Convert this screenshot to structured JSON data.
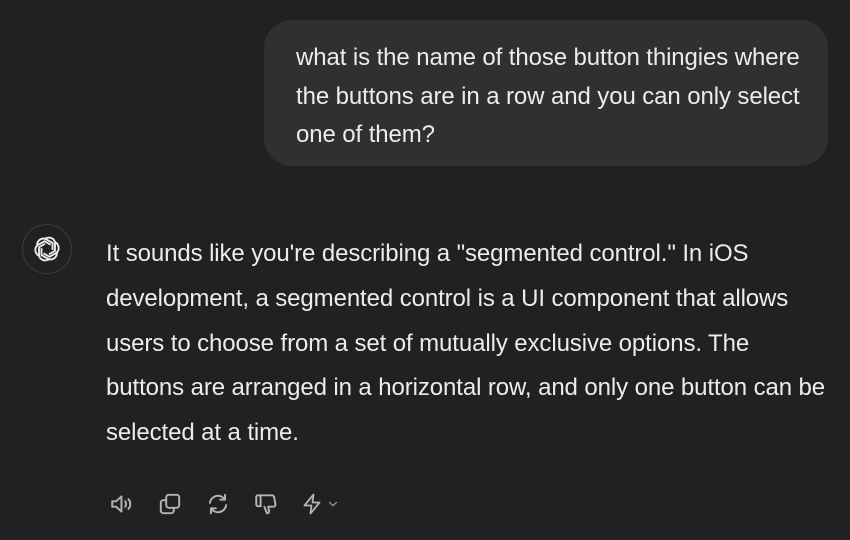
{
  "user_message": {
    "text": "what is the name of those button thingies where the buttons are in a row and you can only select one of them?"
  },
  "assistant_message": {
    "avatar_icon": "openai-logo-icon",
    "text": "It sounds like you're describing a \"segmented control.\" In iOS development, a segmented control is a UI component that allows users to choose from a set of mutually exclusive options. The buttons are arranged in a horizontal row, and only one button can be selected at a time."
  },
  "actions": [
    {
      "icon": "speaker-icon"
    },
    {
      "icon": "copy-icon"
    },
    {
      "icon": "regenerate-icon"
    },
    {
      "icon": "thumbs-down-icon"
    },
    {
      "icon": "lightning-icon"
    }
  ],
  "colors": {
    "background": "#212121",
    "user_bubble": "#303030",
    "text": "#ececec",
    "icon": "#b4b4b4"
  }
}
